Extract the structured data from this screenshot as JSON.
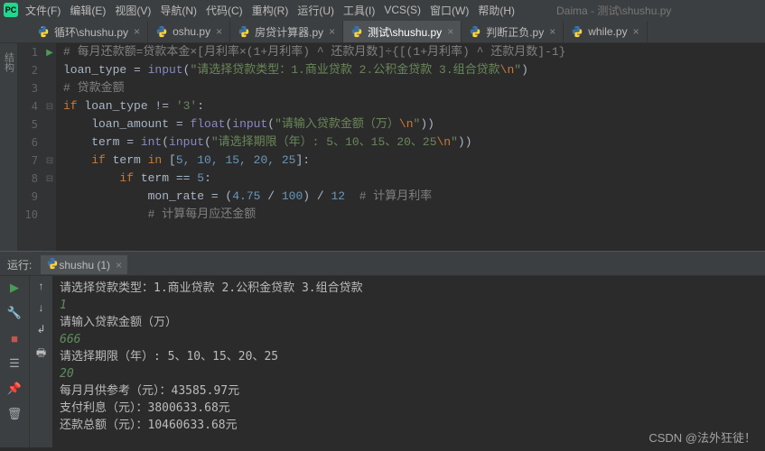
{
  "window": {
    "title": "Daima - 测试\\shushu.py"
  },
  "menu": [
    "文件(F)",
    "编辑(E)",
    "视图(V)",
    "导航(N)",
    "代码(C)",
    "重构(R)",
    "运行(U)",
    "工具(I)",
    "VCS(S)",
    "窗口(W)",
    "帮助(H)"
  ],
  "tabs": [
    {
      "label": "循环\\shushu.py",
      "active": false
    },
    {
      "label": "oshu.py",
      "active": false
    },
    {
      "label": "房贷计算器.py",
      "active": false
    },
    {
      "label": "测试\\shushu.py",
      "active": true
    },
    {
      "label": "判断正负.py",
      "active": false
    },
    {
      "label": "while.py",
      "active": false
    }
  ],
  "left_label": "结构",
  "gutter": [
    {
      "n": "1",
      "run": true,
      "fold": ""
    },
    {
      "n": "2",
      "run": false,
      "fold": ""
    },
    {
      "n": "3",
      "run": false,
      "fold": ""
    },
    {
      "n": "4",
      "run": false,
      "fold": "⊟"
    },
    {
      "n": "5",
      "run": false,
      "fold": ""
    },
    {
      "n": "6",
      "run": false,
      "fold": ""
    },
    {
      "n": "7",
      "run": false,
      "fold": "⊟"
    },
    {
      "n": "8",
      "run": false,
      "fold": "⊟"
    },
    {
      "n": "9",
      "run": false,
      "fold": ""
    },
    {
      "n": "10",
      "run": false,
      "fold": ""
    },
    {
      "n": "",
      "run": false,
      "fold": ""
    }
  ],
  "code": {
    "l1_cm": "# 每月还款额=贷款本金×[月利率×(1+月利率) ^ 还款月数]÷{[(1+月利率) ^ 还款月数]-1}",
    "l2_a": "loan_type = ",
    "l2_fn": "input",
    "l2_s": "\"请选择贷款类型：1.商业贷款 2.公积金贷款 3.组合贷款",
    "l2_e": "\\n",
    "l2_s2": "\"",
    "l3": "# 贷款金额",
    "l4_kw": "if ",
    "l4_b": "loan_type != ",
    "l4_s": "'3'",
    "l4_c": ":",
    "l5_a": "    loan_amount = ",
    "l5_fn": "float",
    "l5_p": "(",
    "l5_fn2": "input",
    "l5_s": "\"请输入贷款金额（万）",
    "l5_e": "\\n",
    "l5_s2": "\"",
    "l5_p2": "))",
    "l6_a": "    term = ",
    "l6_fn": "int",
    "l6_p": "(",
    "l6_fn2": "input",
    "l6_s": "\"请选择期限（年）: 5、10、15、20、25",
    "l6_e": "\\n",
    "l6_s2": "\"",
    "l6_p2": "))",
    "l7_kw": "    if ",
    "l7_a": "term ",
    "l7_kw2": "in ",
    "l7_b": "[",
    "l7_n": "5, 10, 15, 20, 25",
    "l7_c": "]:",
    "l8_kw": "        if ",
    "l8_a": "term == ",
    "l8_n": "5",
    "l8_c": ":",
    "l9_a": "            mon_rate = (",
    "l9_n1": "4.75",
    " l9_o": " / ",
    "l9_n2": "100",
    "l9_b": ") / ",
    "l9_n3": "12",
    "l9_cm": "  # 计算月利率",
    "l10": "            # 计算每月应还金额"
  },
  "tool": {
    "label": "运行:",
    "tab": "shushu (1)"
  },
  "console": {
    "l1": "请选择贷款类型：1.商业贷款 2.公积金贷款 3.组合贷款",
    "i1": "1",
    "l2": "请输入贷款金额（万）",
    "i2": "666",
    "l3": "请选择期限（年）: 5、10、15、20、25",
    "i3": "20",
    "l4": "每月月供参考（元）：43585.97元",
    "l5": "支付利息（元）：3800633.68元",
    "l6": "还款总额（元）：10460633.68元"
  },
  "watermark": "CSDN @法外狂徒！"
}
